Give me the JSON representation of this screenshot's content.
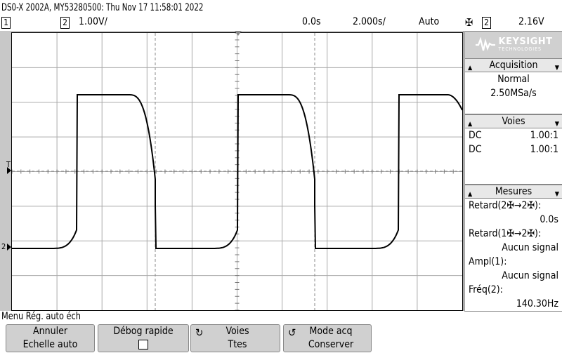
{
  "title": "DS0-X 2002A, MY53280500: Thu Nov 17 11:58:01 2022",
  "topbar": {
    "ch1_label": "1",
    "ch2_label": "2",
    "ch2_scale": "1.00V/",
    "delay": "0.0s",
    "timebase": "2.000s/",
    "mode": "Auto",
    "trigger_edge": "✠",
    "trigger_source": "2",
    "trigger_level": "2.16V"
  },
  "logo": {
    "brand": "KEYSIGHT",
    "sub": "TECHNOLOGIES"
  },
  "acquisition": {
    "header": "Acquisition",
    "mode": "Normal",
    "rate": "2.50MSa/s"
  },
  "channels": {
    "header": "Voies",
    "rows": [
      {
        "coupling": "DC",
        "ratio": "1.00:1"
      },
      {
        "coupling": "DC",
        "ratio": "1.00:1"
      }
    ]
  },
  "measurements": {
    "header": "Mesures",
    "items": [
      {
        "label": "Retard(2✠→2✠):",
        "value": "0.0s"
      },
      {
        "label": "Retard(1✠→2✠):",
        "value": "Aucun signal"
      },
      {
        "label": "Ampl(1):",
        "value": "Aucun signal"
      },
      {
        "label": "Fréq(2):",
        "value": "140.30Hz"
      }
    ]
  },
  "menu_title": "Menu Rég. auto éch",
  "softkeys": [
    {
      "line1": "Annuler",
      "line2": "Echelle auto"
    },
    {
      "line1": "Débog rapide",
      "line2": ""
    },
    {
      "line1": "Voies",
      "line2": "Ttes"
    },
    {
      "line1": "Mode acq",
      "line2": "Conserver"
    }
  ],
  "markers": {
    "trigger_marker": "T",
    "ch2_marker": "2"
  },
  "colors": {
    "screen_bg": "#ffffff",
    "trace": "#000000",
    "bezel": "#c8c8c8",
    "softkey_bg": "#d0d0d0"
  }
}
